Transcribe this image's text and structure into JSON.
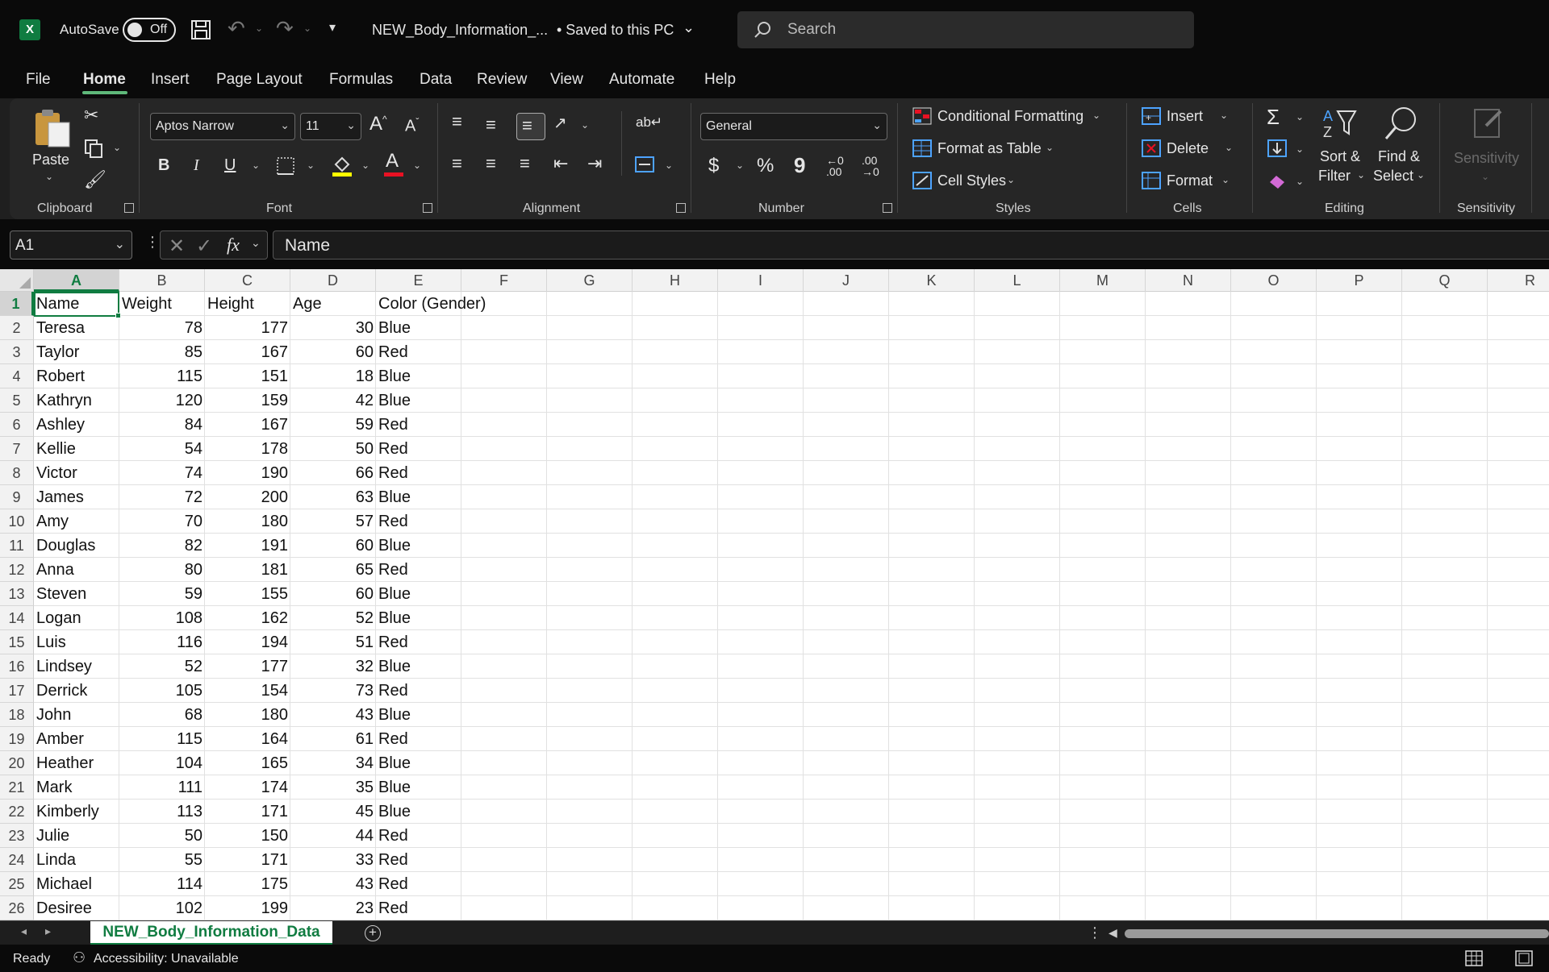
{
  "titlebar": {
    "app_icon": "excel-icon",
    "autosave_label": "AutoSave",
    "autosave_state": "Off",
    "file_name": "NEW_Body_Information_...",
    "save_status": "• Saved to this PC",
    "search_placeholder": "Search"
  },
  "tabs": [
    "File",
    "Home",
    "Insert",
    "Page Layout",
    "Formulas",
    "Data",
    "Review",
    "View",
    "Automate",
    "Help"
  ],
  "ribbon": {
    "clipboard": {
      "label": "Clipboard",
      "paste": "Paste"
    },
    "font": {
      "label": "Font",
      "font_name": "Aptos Narrow",
      "font_size": "11",
      "bold": "B",
      "italic": "I",
      "underline": "U"
    },
    "alignment": {
      "label": "Alignment"
    },
    "number": {
      "label": "Number",
      "format": "General",
      "currency": "$",
      "percent": "%",
      "comma": "9"
    },
    "styles": {
      "label": "Styles",
      "conditional": "Conditional Formatting",
      "format_table": "Format as Table",
      "cell_styles": "Cell Styles"
    },
    "cells": {
      "label": "Cells",
      "insert": "Insert",
      "delete": "Delete",
      "format": "Format"
    },
    "editing": {
      "label": "Editing",
      "sort_line1": "Sort &",
      "sort_line2": "Filter",
      "find_line1": "Find &",
      "find_line2": "Select"
    },
    "sensitivity": {
      "label": "Sensitivity",
      "button": "Sensitivity"
    }
  },
  "formula_bar": {
    "name_box": "A1",
    "fx": "fx",
    "value": "Name"
  },
  "columns": [
    "A",
    "B",
    "C",
    "D",
    "E",
    "F",
    "G",
    "H",
    "I",
    "J",
    "K",
    "L",
    "M",
    "N",
    "O",
    "P",
    "Q",
    "R"
  ],
  "table": {
    "headers": [
      "Name",
      "Weight",
      "Height",
      "Age",
      "Color (Gender)"
    ],
    "rows": [
      [
        "Teresa",
        "78",
        "177",
        "30",
        "Blue"
      ],
      [
        "Taylor",
        "85",
        "167",
        "60",
        "Red"
      ],
      [
        "Robert",
        "115",
        "151",
        "18",
        "Blue"
      ],
      [
        "Kathryn",
        "120",
        "159",
        "42",
        "Blue"
      ],
      [
        "Ashley",
        "84",
        "167",
        "59",
        "Red"
      ],
      [
        "Kellie",
        "54",
        "178",
        "50",
        "Red"
      ],
      [
        "Victor",
        "74",
        "190",
        "66",
        "Red"
      ],
      [
        "James",
        "72",
        "200",
        "63",
        "Blue"
      ],
      [
        "Amy",
        "70",
        "180",
        "57",
        "Red"
      ],
      [
        "Douglas",
        "82",
        "191",
        "60",
        "Blue"
      ],
      [
        "Anna",
        "80",
        "181",
        "65",
        "Red"
      ],
      [
        "Steven",
        "59",
        "155",
        "60",
        "Blue"
      ],
      [
        "Logan",
        "108",
        "162",
        "52",
        "Blue"
      ],
      [
        "Luis",
        "116",
        "194",
        "51",
        "Red"
      ],
      [
        "Lindsey",
        "52",
        "177",
        "32",
        "Blue"
      ],
      [
        "Derrick",
        "105",
        "154",
        "73",
        "Red"
      ],
      [
        "John",
        "68",
        "180",
        "43",
        "Blue"
      ],
      [
        "Amber",
        "115",
        "164",
        "61",
        "Red"
      ],
      [
        "Heather",
        "104",
        "165",
        "34",
        "Blue"
      ],
      [
        "Mark",
        "111",
        "174",
        "35",
        "Blue"
      ],
      [
        "Kimberly",
        "113",
        "171",
        "45",
        "Blue"
      ],
      [
        "Julie",
        "50",
        "150",
        "44",
        "Red"
      ],
      [
        "Linda",
        "55",
        "171",
        "33",
        "Red"
      ],
      [
        "Michael",
        "114",
        "175",
        "43",
        "Red"
      ],
      [
        "Desiree",
        "102",
        "199",
        "23",
        "Red"
      ]
    ]
  },
  "sheet": {
    "tab_name": "NEW_Body_Information_Data"
  },
  "status": {
    "ready": "Ready",
    "accessibility": "Accessibility: Unavailable"
  },
  "colors": {
    "accent": "#107c41",
    "ribbon_bg": "#262626",
    "titlebar_bg": "#0a0a0a"
  }
}
